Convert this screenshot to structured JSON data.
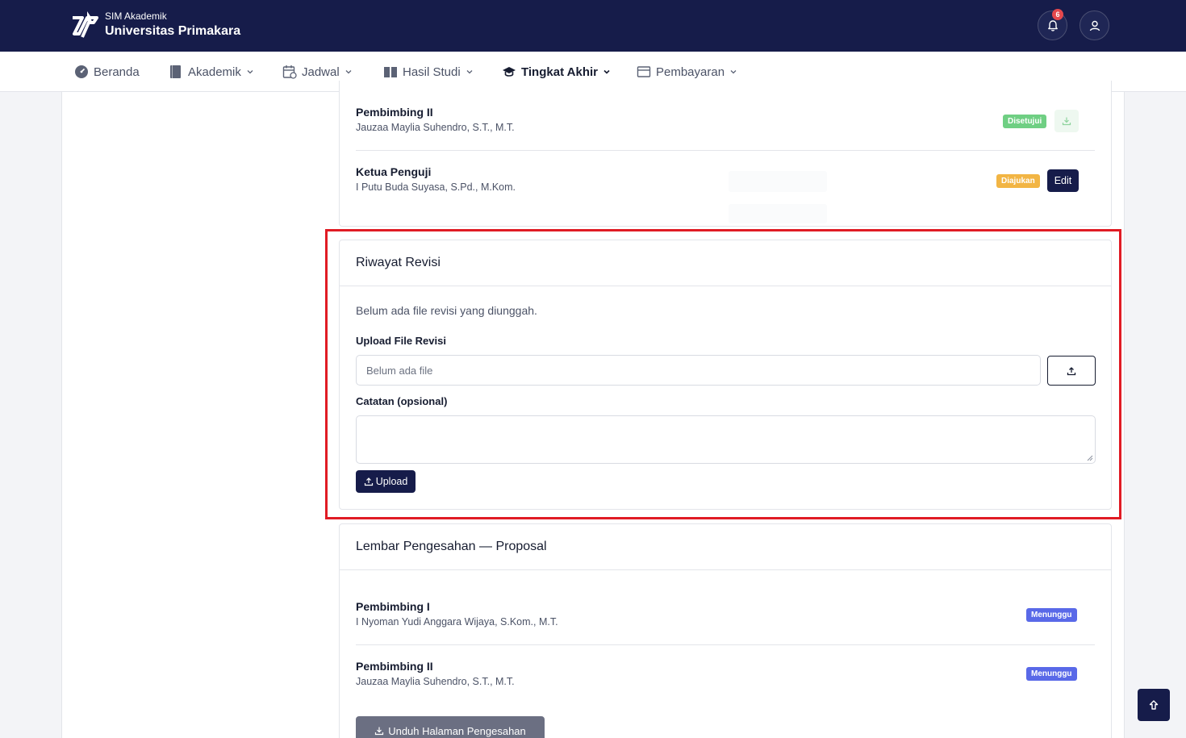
{
  "header": {
    "app_subtitle": "SIM Akademik",
    "app_title": "Universitas Primakara",
    "notification_count": "6"
  },
  "nav": {
    "items": [
      {
        "label": "Beranda",
        "icon": "dashboard-icon",
        "dropdown": false
      },
      {
        "label": "Akademik",
        "icon": "book-icon",
        "dropdown": true
      },
      {
        "label": "Jadwal",
        "icon": "calendar-icon",
        "dropdown": true
      },
      {
        "label": "Hasil Studi",
        "icon": "open-book-icon",
        "dropdown": true
      },
      {
        "label": "Tingkat Akhir",
        "icon": "graduation-cap-icon",
        "dropdown": true,
        "active": true
      },
      {
        "label": "Pembayaran",
        "icon": "wallet-icon",
        "dropdown": true
      }
    ]
  },
  "previous_card": {
    "rows": [
      {
        "title": "Pembimbing II",
        "name": "Jauzaa Maylia Suhendro, S.T., M.T.",
        "status": "Disetujui",
        "action_icon": "download-icon"
      },
      {
        "title": "Ketua Penguji",
        "name": "I Putu Buda Suyasa, S.Pd., M.Kom.",
        "status": "Diajukan",
        "action_label": "Edit"
      }
    ]
  },
  "revision": {
    "title": "Riwayat Revisi",
    "empty_message": "Belum ada file revisi yang diunggah.",
    "file_label": "Upload File Revisi",
    "file_placeholder": "Belum ada file",
    "notes_label": "Catatan (opsional)",
    "notes_value": "",
    "upload_label": "Upload"
  },
  "pengesahan": {
    "title": "Lembar Pengesahan — Proposal",
    "rows": [
      {
        "title": "Pembimbing I",
        "name": "I Nyoman Yudi Anggara Wijaya, S.Kom., M.T.",
        "status": "Menunggu"
      },
      {
        "title": "Pembimbing II",
        "name": "Jauzaa Maylia Suhendro, S.T., M.T.",
        "status": "Menunggu"
      }
    ],
    "download_label": "Unduh Halaman Pengesahan"
  },
  "colors": {
    "header_bg": "#161c4a",
    "approved": "#6fcf83",
    "submitted": "#f2b544",
    "waiting": "#5969e8",
    "highlight": "#e01b24"
  }
}
